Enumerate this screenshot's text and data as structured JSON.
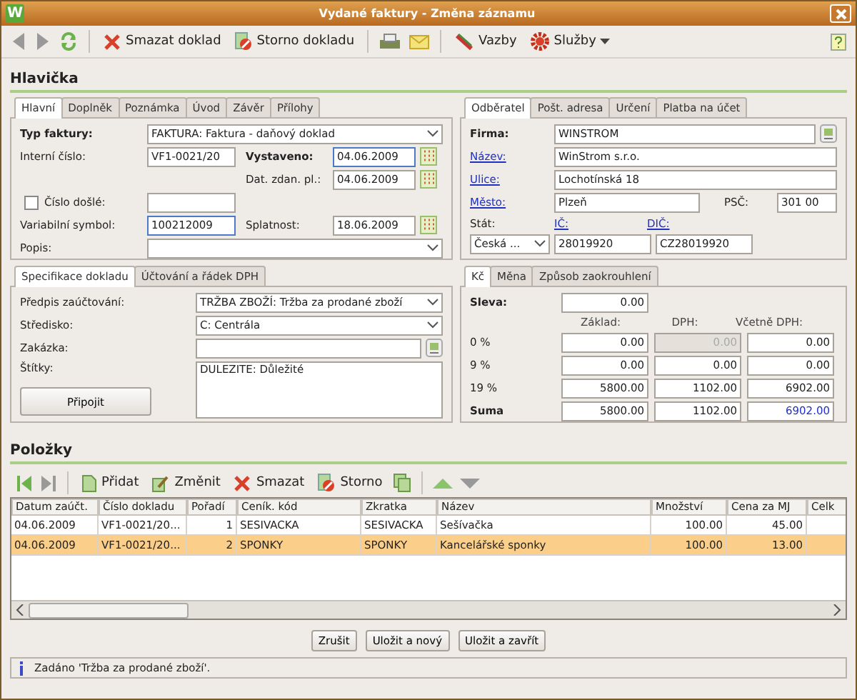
{
  "window": {
    "logo": "W",
    "title": "Vydané faktury - Změna záznamu"
  },
  "toolbar": {
    "delete": "Smazat doklad",
    "cancel": "Storno dokladu",
    "links": "Vazby",
    "services": "Služby"
  },
  "header": {
    "title": "Hlavička",
    "main_tabs": [
      {
        "label": "Hlavní",
        "selected": true
      },
      {
        "label": "Doplněk",
        "selected": false
      },
      {
        "label": "Poznámka",
        "selected": false
      },
      {
        "label": "Úvod",
        "selected": false
      },
      {
        "label": "Závěr",
        "selected": false
      },
      {
        "label": "Přílohy",
        "selected": false
      }
    ],
    "invoice_type": {
      "label": "Typ faktury:",
      "value": "FAKTURA: Faktura - daňový doklad"
    },
    "internal_number": {
      "label": "Interní číslo:",
      "value": "VF1-0021/20"
    },
    "issued": {
      "label": "Vystaveno:",
      "value": "04.06.2009",
      "focused": true
    },
    "tax_date": {
      "label": "Dat. zdan. pl.:",
      "value": "04.06.2009",
      "focused": false
    },
    "received_number": {
      "label": "Číslo došlé:",
      "checked": false
    },
    "variable_symbol": {
      "label": "Variabilní symbol:",
      "value": "100212009",
      "focused": true
    },
    "due": {
      "label": "Splatnost:",
      "value": "18.06.2009",
      "focused": false
    },
    "description": {
      "label": "Popis:"
    },
    "customer_tabs": [
      {
        "label": "Odběratel",
        "selected": true
      },
      {
        "label": "Pošt. adresa",
        "selected": false
      },
      {
        "label": "Určení",
        "selected": false
      },
      {
        "label": "Platba na účet",
        "selected": false
      }
    ],
    "company": {
      "label": "Firma:",
      "value": "WINSTROM"
    },
    "name": {
      "label": "Název:",
      "value": "WinStrom s.r.o.",
      "link": true
    },
    "street": {
      "label": "Ulice:",
      "value": "Lochotínská 18",
      "link": true
    },
    "city": {
      "label": "Město:",
      "value": "Plzeň",
      "link": true
    },
    "zip": {
      "label": "PSČ:",
      "value": "301 00"
    },
    "country": {
      "label": "Stát:",
      "value": "Česká ..."
    },
    "ico": {
      "label": "IČ:",
      "value": "28019920",
      "link": true
    },
    "dic": {
      "label": "DIČ:",
      "value": "CZ28019920",
      "link": true
    },
    "spec_tabs": [
      {
        "label": "Specifikace dokladu",
        "selected": true
      },
      {
        "label": "Účtování a řádek DPH",
        "selected": false
      }
    ],
    "posting": {
      "label": "Předpis zaúčtování:",
      "value": "TRŽBA ZBOŽÍ: Tržba za prodané zboží"
    },
    "centre": {
      "label": "Středisko:",
      "value": "C: Centrála"
    },
    "order": {
      "label": "Zakázka:"
    },
    "tags": {
      "label": "Štítky:",
      "value": "DULEZITE: Důležité"
    },
    "attach": "Připojit",
    "totals_tabs": [
      {
        "label": "Kč",
        "selected": true
      },
      {
        "label": "Měna",
        "selected": false
      },
      {
        "label": "Způsob zaokrouhlení",
        "selected": false
      }
    ],
    "discount": {
      "label": "Sleva:",
      "value": "0.00"
    },
    "totals_columns": [
      "Základ:",
      "DPH:",
      "Včetně DPH:"
    ],
    "totals_rows": [
      {
        "kind": "rate",
        "label": "0 %",
        "base": "0.00",
        "vat": "0.00",
        "total": "0.00",
        "vat_disabled": true
      },
      {
        "kind": "rate",
        "label": "9 %",
        "base": "0.00",
        "vat": "0.00",
        "total": "0.00",
        "vat_disabled": false
      },
      {
        "kind": "rate",
        "label": "19 %",
        "base": "5800.00",
        "vat": "1102.00",
        "total": "6902.00",
        "vat_disabled": false
      },
      {
        "kind": "sum",
        "label": "Suma",
        "base": "5800.00",
        "vat": "1102.00",
        "total": "6902.00",
        "vat_disabled": false
      }
    ]
  },
  "items": {
    "title": "Položky",
    "toolbar": [
      {
        "kind": "add",
        "label": "Přidat"
      },
      {
        "kind": "edit",
        "label": "Změnit"
      },
      {
        "kind": "delete",
        "label": "Smazat"
      },
      {
        "kind": "cancel",
        "label": "Storno"
      }
    ],
    "columns": [
      "Datum zaúčt.",
      "Číslo dokladu",
      "Pořadí",
      "Ceník. kód",
      "Zkratka",
      "Název",
      "Množství",
      "Cena za MJ",
      "Celk"
    ],
    "rows": [
      {
        "selected": false,
        "cells": [
          "04.06.2009",
          "VF1-0021/20...",
          "1",
          "SESIVACKA",
          "SESIVACKA",
          "Sešívačka",
          "100.00",
          "45.00"
        ]
      },
      {
        "selected": true,
        "cells": [
          "04.06.2009",
          "VF1-0021/20...",
          "2",
          "SPONKY",
          "SPONKY",
          "Kancelářské sponky",
          "100.00",
          "13.00"
        ]
      }
    ]
  },
  "buttons": [
    "Zrušit",
    "Uložit a nový",
    "Uložit a zavřít"
  ],
  "status": "Zadáno 'Tržba za prodané zboží'."
}
